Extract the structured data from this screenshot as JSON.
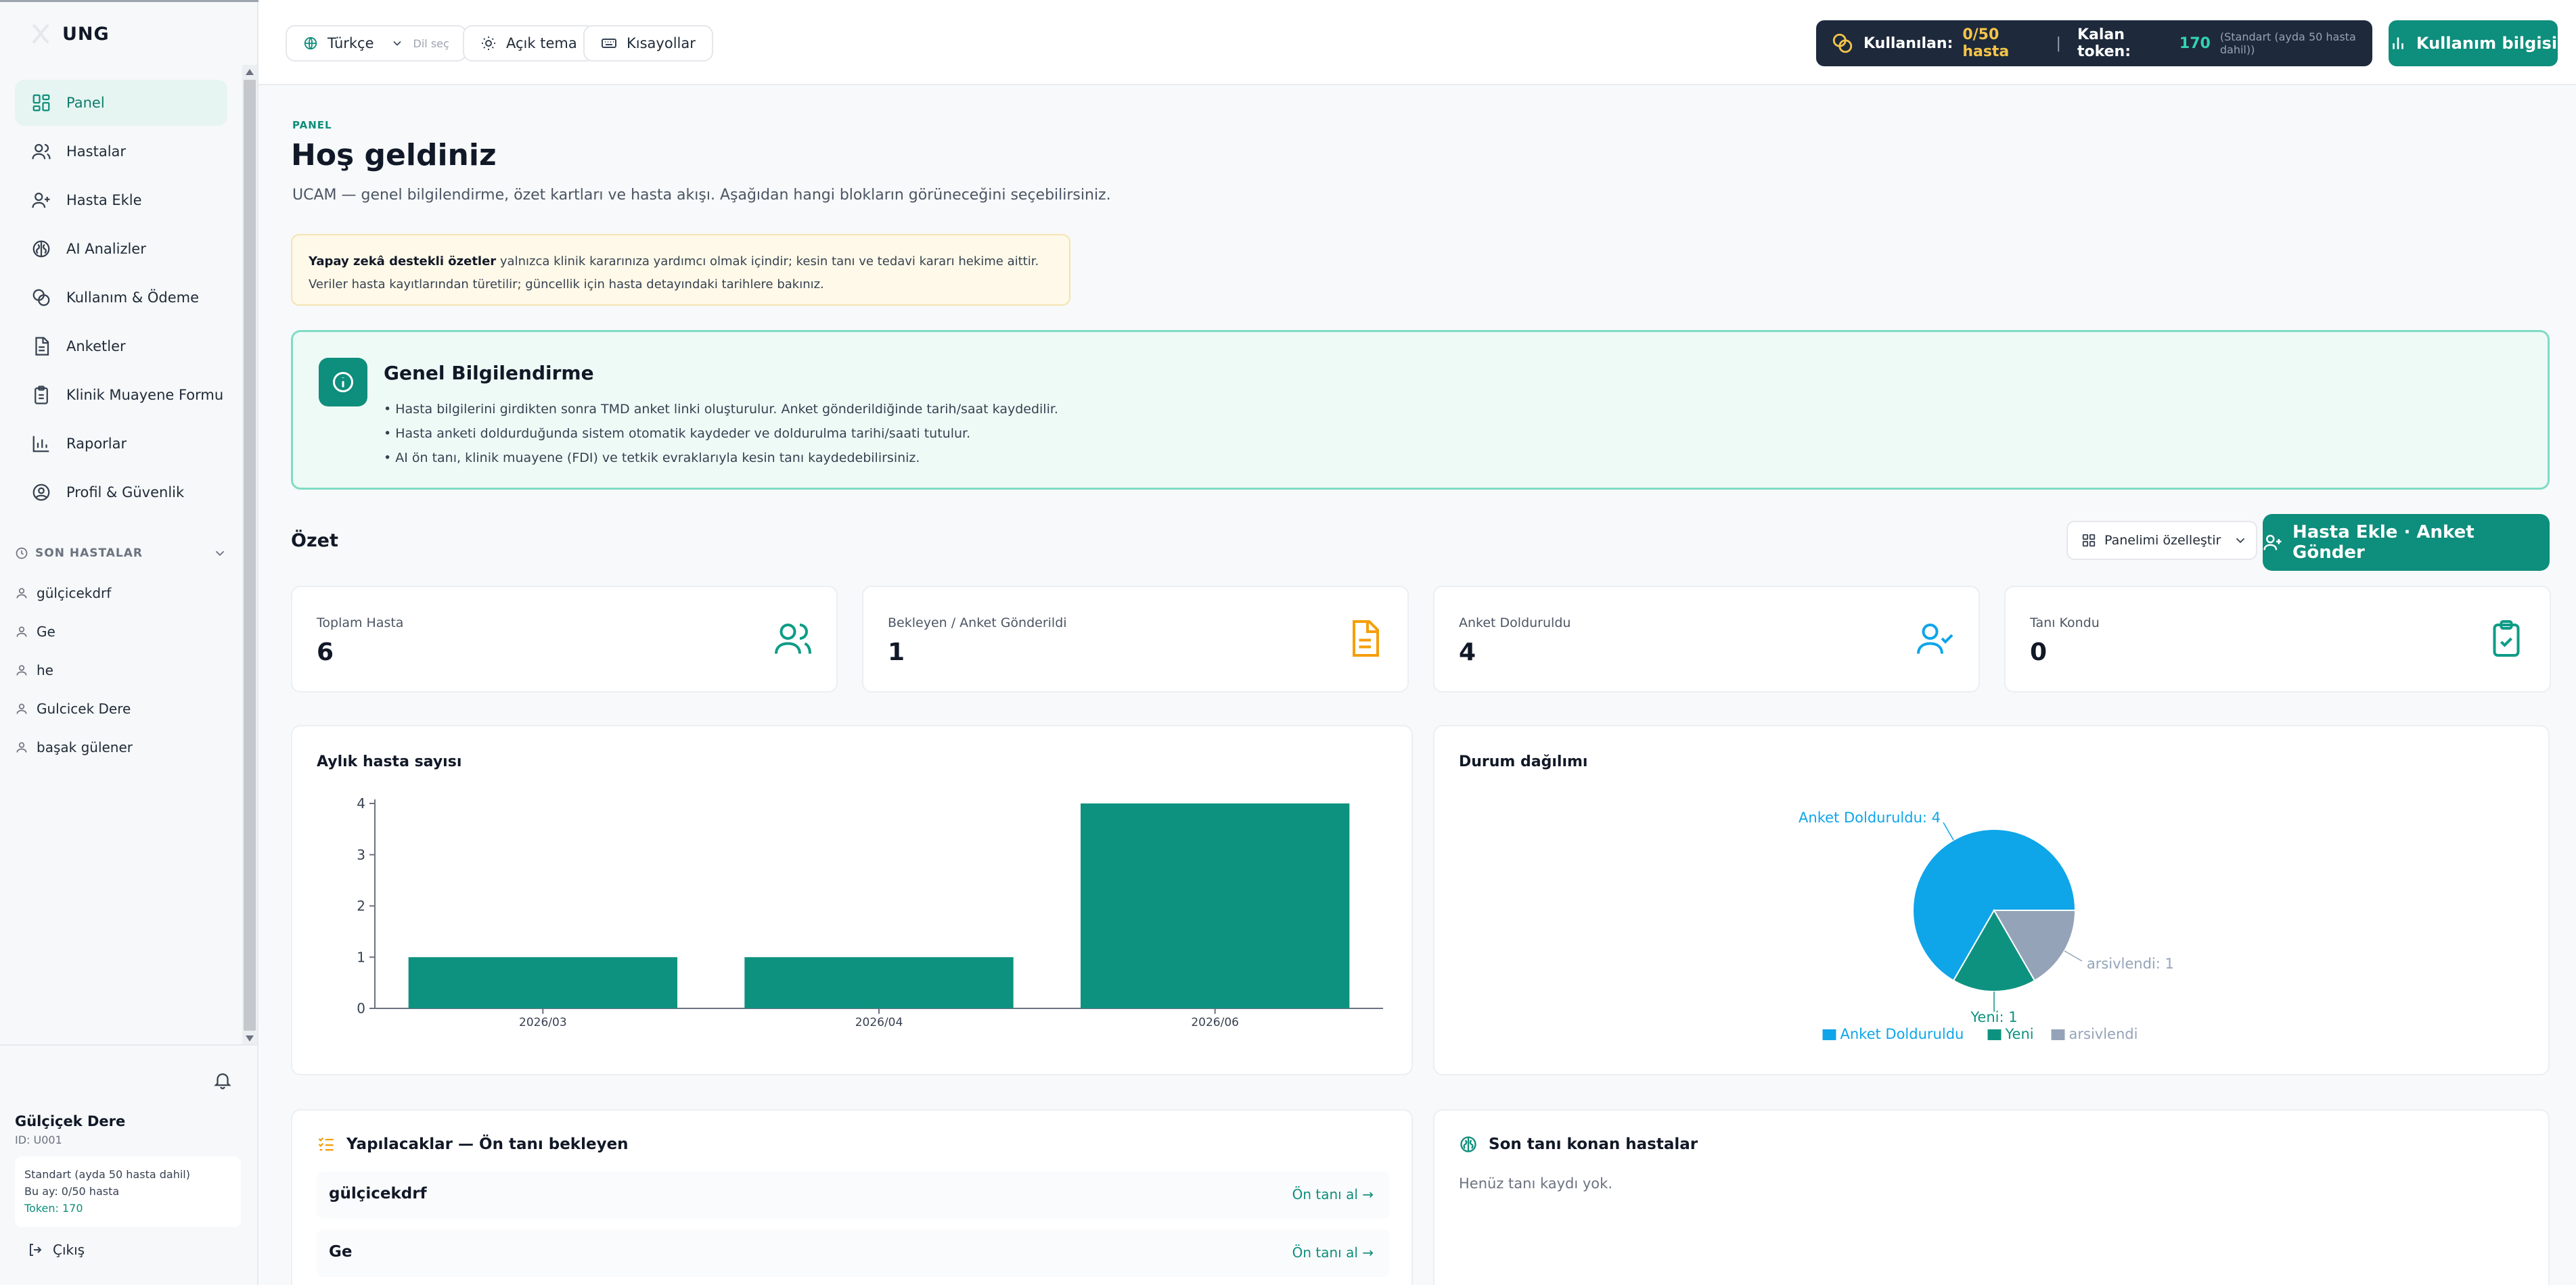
{
  "brand": {
    "name": "UNG"
  },
  "sidebar": {
    "items": [
      {
        "label": "Panel",
        "icon": "dashboard-icon",
        "active": true
      },
      {
        "label": "Hastalar",
        "icon": "users-icon"
      },
      {
        "label": "Hasta Ekle",
        "icon": "user-plus-icon"
      },
      {
        "label": "AI Analizler",
        "icon": "brain-icon"
      },
      {
        "label": "Kullanım & Ödeme",
        "icon": "coins-icon"
      },
      {
        "label": "Anketler",
        "icon": "file-text-icon"
      },
      {
        "label": "Klinik Muayene Formu",
        "icon": "clipboard-icon"
      },
      {
        "label": "Raporlar",
        "icon": "bar-chart-icon"
      },
      {
        "label": "Profil & Güvenlik",
        "icon": "user-circle-icon"
      }
    ],
    "recent_title": "SON HASTALAR",
    "recent": [
      "gülçicekdrf",
      "Ge",
      "he",
      "Gulcicek Dere",
      "başak gülener"
    ],
    "user": {
      "name": "Gülçiçek Dere",
      "id": "ID: U001",
      "plan": "Standart (ayda 50 hasta dahil)",
      "month": "Bu ay: 0/50 hasta",
      "token": "Token: 170"
    },
    "logout": "Çıkış"
  },
  "topbar": {
    "language": "Türkçe",
    "language_hint": "Dil seç",
    "theme": "Açık tema",
    "shortcuts": "Kısayollar",
    "usage_label": "Kullanılan:",
    "usage_value": "0/50 hasta",
    "token_label": "Kalan token:",
    "token_value": "170",
    "plan_note": "(Standart (ayda 50 hasta dahil))",
    "usage_button": "Kullanım bilgisi"
  },
  "page": {
    "kicker": "PANEL",
    "title": "Hoş geldiniz",
    "description": "UCAM — genel bilgilendirme, özet kartları ve hasta akışı. Aşağıdan hangi blokların görüneceğini seçebilirsiniz.",
    "disclaimer_bold": "Yapay zekâ destekli özetler",
    "disclaimer_rest": " yalnızca klinik kararınıza yardımcı olmak içindir; kesin tanı ve tedavi kararı hekime aittir.",
    "disclaimer_line2": "Veriler hasta kayıtlarından türetilir; güncellik için hasta detayındaki tarihlere bakınız."
  },
  "info": {
    "title": "Genel Bilgilendirme",
    "bullets": [
      "• Hasta bilgilerini girdikten sonra TMD anket linki oluşturulur. Anket gönderildiğinde tarih/saat kaydedilir.",
      "• Hasta anketi doldurduğunda sistem otomatik kaydeder ve doldurulma tarihi/saati tutulur.",
      "• AI ön tanı, klinik muayene (FDI) ve tetkik evraklarıyla kesin tanı kaydedebilirsiniz."
    ]
  },
  "summary": {
    "title": "Özet",
    "customize": "Panelimi özelleştir",
    "primary": "Hasta Ekle · Anket Gönder",
    "stats": [
      {
        "label": "Toplam Hasta",
        "value": "6",
        "icon": "users-icon",
        "color": "#0e9c86"
      },
      {
        "label": "Bekleyen / Anket Gönderildi",
        "value": "1",
        "icon": "file-text-icon",
        "color": "#f59e0b"
      },
      {
        "label": "Anket Dolduruldu",
        "value": "4",
        "icon": "user-check-icon",
        "color": "#0ea5e9"
      },
      {
        "label": "Tanı Kondu",
        "value": "0",
        "icon": "clipboard-check-icon",
        "color": "#0e9c86"
      }
    ]
  },
  "chart_data": [
    {
      "type": "bar",
      "title": "Aylık hasta sayısı",
      "categories": [
        "2026/03",
        "2026/04",
        "2026/06"
      ],
      "values": [
        1,
        1,
        4
      ],
      "ylim": [
        0,
        4
      ],
      "yticks": [
        "0",
        "1",
        "2",
        "3",
        "4"
      ],
      "color": "#0e9280"
    },
    {
      "type": "pie",
      "title": "Durum dağılımı",
      "slices": [
        {
          "name": "Anket Dolduruldu",
          "value": 4,
          "label": "Anket Dolduruldu: 4",
          "color": "#0ea5e9"
        },
        {
          "name": "Yeni",
          "value": 1,
          "label": "Yeni: 1",
          "color": "#0e9280"
        },
        {
          "name": "arsivlendi",
          "value": 1,
          "label": "arsivlendi: 1",
          "color": "#94a3b8"
        }
      ],
      "legend": "bottom"
    }
  ],
  "todo": {
    "title": "Yapılacaklar — Ön tanı bekleyen",
    "rows": [
      {
        "name": "gülçicekdrf",
        "action": "Ön tanı al →"
      },
      {
        "name": "Ge",
        "action": "Ön tanı al →"
      }
    ]
  },
  "recent_dx": {
    "title": "Son tanı konan hastalar",
    "empty": "Henüz tanı kaydı yok."
  }
}
